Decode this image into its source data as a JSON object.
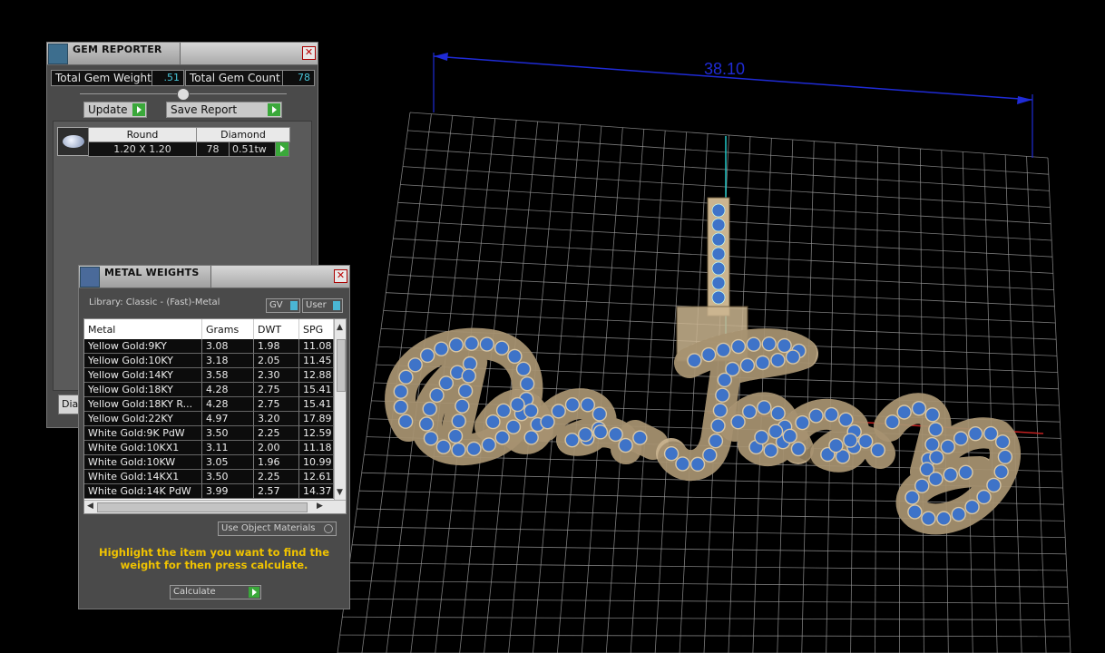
{
  "viewport": {
    "dimension_label": "38.10",
    "colors": {
      "grid": "#9a9a9a",
      "dimension": "#1f2bd6",
      "metal": "#cbb590",
      "gem": "#3e73c8"
    }
  },
  "gem_reporter": {
    "title": "GEM REPORTER",
    "total_weight_label": "Total Gem Weight",
    "total_weight_value": ".51",
    "total_count_label": "Total Gem Count",
    "total_count_value": "78",
    "update_label": "Update",
    "save_report_label": "Save Report",
    "gem": {
      "shape": "Round",
      "material": "Diamond",
      "size": "1.20 X 1.20",
      "count": "78",
      "weight": "0.51tw"
    },
    "bottom_tab": "Dia"
  },
  "metal_weights": {
    "title": "METAL WEIGHTS",
    "library": "Library: Classic - (Fast)-Metal",
    "gv_label": "GV",
    "user_label": "User",
    "columns": [
      "Metal",
      "Grams",
      "DWT",
      "SPG"
    ],
    "rows": [
      [
        "Yellow Gold:9KY",
        "3.08",
        "1.98",
        "11.08"
      ],
      [
        "Yellow Gold:10KY",
        "3.18",
        "2.05",
        "11.45"
      ],
      [
        "Yellow Gold:14KY",
        "3.58",
        "2.30",
        "12.88"
      ],
      [
        "Yellow Gold:18KY",
        "4.28",
        "2.75",
        "15.41"
      ],
      [
        "Yellow Gold:18KY R...",
        "4.28",
        "2.75",
        "15.41"
      ],
      [
        "Yellow Gold:22KY",
        "4.97",
        "3.20",
        "17.89"
      ],
      [
        "White Gold:9K PdW",
        "3.50",
        "2.25",
        "12.59"
      ],
      [
        "White Gold:10KX1",
        "3.11",
        "2.00",
        "11.18"
      ],
      [
        "White Gold:10KW",
        "3.05",
        "1.96",
        "10.99"
      ],
      [
        "White Gold:14KX1",
        "3.50",
        "2.25",
        "12.61"
      ],
      [
        "White Gold:14K PdW",
        "3.99",
        "2.57",
        "14.37"
      ]
    ],
    "use_object_materials": "Use Object Materials",
    "hint": "Highlight the item you want to find the weight for then press calculate.",
    "calculate_label": "Calculate"
  }
}
